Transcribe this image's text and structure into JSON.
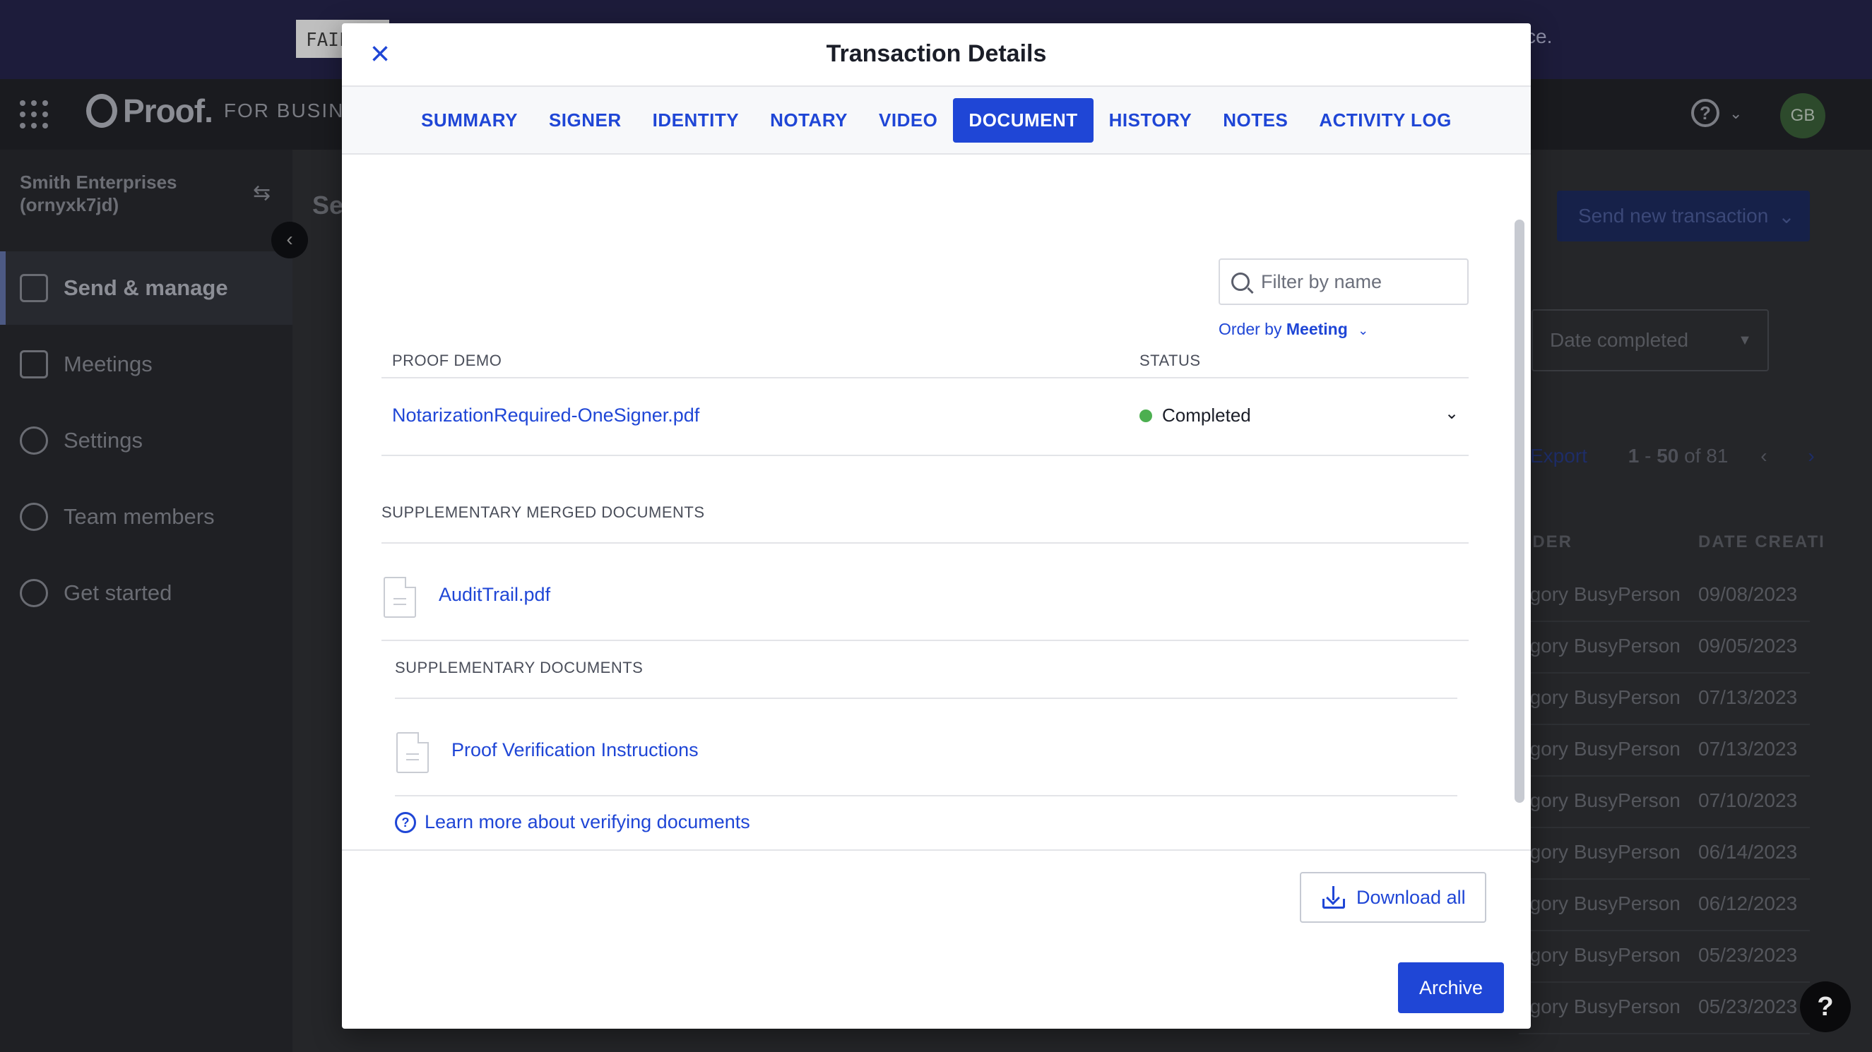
{
  "banner": {
    "tag": "FAIL",
    "tail": "ce."
  },
  "topnav": {
    "logo": "Proof.",
    "logo_sub": "FOR BUSINESS",
    "avatar": "GB",
    "help_icon": "?"
  },
  "sidebar": {
    "org_name": "Smith Enterprises (ornyxk7jd)",
    "items": [
      {
        "label": "Send & manage",
        "icon": "dashboard-icon",
        "active": true
      },
      {
        "label": "Meetings",
        "icon": "calendar-icon"
      },
      {
        "label": "Settings",
        "icon": "gear-icon"
      },
      {
        "label": "Team members",
        "icon": "users-icon"
      },
      {
        "label": "Get started",
        "icon": "rocket-icon"
      }
    ]
  },
  "main": {
    "title": "Se",
    "send_new": "Send new transaction",
    "date_select": "Date completed",
    "export": "Export",
    "pager": {
      "start": "1",
      "end": "50",
      "total": "81"
    },
    "col_sender": "NDER",
    "col_date": "DATE CREATI",
    "rows": [
      {
        "sender": "egory BusyPerson",
        "date": "09/08/2023"
      },
      {
        "sender": "egory BusyPerson",
        "date": "09/05/2023"
      },
      {
        "sender": "egory BusyPerson",
        "date": "07/13/2023"
      },
      {
        "sender": "egory BusyPerson",
        "date": "07/13/2023"
      },
      {
        "sender": "egory BusyPerson",
        "date": "07/10/2023"
      },
      {
        "sender": "egory BusyPerson",
        "date": "06/14/2023"
      },
      {
        "sender": "egory BusyPerson",
        "date": "06/12/2023"
      },
      {
        "sender": "egory BusyPerson",
        "date": "05/23/2023"
      },
      {
        "sender": "egory BusyPerson",
        "date": "05/23/2023"
      }
    ]
  },
  "modal": {
    "title": "Transaction Details",
    "tabs": [
      "SUMMARY",
      "SIGNER",
      "IDENTITY",
      "NOTARY",
      "VIDEO",
      "DOCUMENT",
      "HISTORY",
      "NOTES",
      "ACTIVITY LOG"
    ],
    "active_tab": "DOCUMENT",
    "filter_placeholder": "Filter by name",
    "order_prefix": "Order by",
    "order_value": "Meeting",
    "table": {
      "col_name": "PROOF DEMO",
      "col_status": "STATUS",
      "document": "NotarizationRequired-OneSigner.pdf",
      "status": "Completed",
      "status_color": "#4caf50"
    },
    "supp_merged": {
      "label": "SUPPLEMENTARY MERGED DOCUMENTS",
      "file": "AuditTrail.pdf"
    },
    "supp_docs": {
      "label": "SUPPLEMENTARY DOCUMENTS",
      "file": "Proof Verification Instructions"
    },
    "learn_more": "Learn more about verifying documents",
    "download_all": "Download all",
    "archive": "Archive",
    "accent_color": "#1f46d6"
  }
}
